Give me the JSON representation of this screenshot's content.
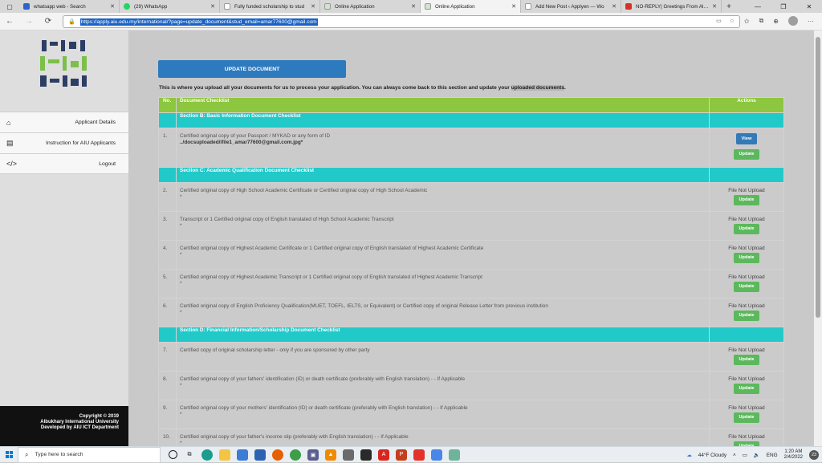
{
  "browser": {
    "tabs": [
      {
        "label": "whatsapp web - Search",
        "color": "#2a66c9"
      },
      {
        "label": "(29) WhatsApp",
        "color": "#25d366"
      },
      {
        "label": "Fully funded scholarship to stud",
        "color": "#9e9e9e"
      },
      {
        "label": "Online Application",
        "color": "#9e9e9e"
      },
      {
        "label": "Online Application",
        "color": "#9e9e9e",
        "active": true
      },
      {
        "label": "Add New Post ‹ Applyen — Wo",
        "color": "#9e9e9e"
      },
      {
        "label": "NO-REPLY| Greetings From Albu",
        "color": "#d93025"
      }
    ],
    "url": "https://apply.aiu.edu.my/international/?page=update_document&stud_email=amar77600@gmail.com"
  },
  "sidebar": {
    "items": [
      {
        "label": "Applicant Details",
        "icon": "home-icon"
      },
      {
        "label": "Instruction for AIU Applicants",
        "icon": "print-icon"
      },
      {
        "label": "Logout",
        "icon": "code-icon"
      }
    ],
    "footer": {
      "line1": "Copyright © 2019",
      "line2": "Albukhary International University",
      "line3": "Developed by AIU ICT Department"
    }
  },
  "main": {
    "update_button": "UPDATE DOCUMENT",
    "intro_text": "This is where you upload all your documents for us to process your application. You can always come back to this section and update your ",
    "intro_highlight": "uploaded documents",
    "intro_end": ".",
    "table": {
      "headers": {
        "no": "No.",
        "checklist": "Document Checklist",
        "actions": "Actions"
      },
      "section_b": "Section B: Basic Information Document Checklist",
      "section_c": "Section C: Academic Qualification Document Checklist",
      "section_d": "Section D: Financial Information/Scholarship Document Checklist",
      "rows": [
        {
          "no": "1.",
          "desc": "Certified original copy of your Passport / MYKAD or any form of ID",
          "path": "../docsuploaded/ifile1_amar77600@gmail.com.jpg",
          "star": "*"
        },
        {
          "no": "2.",
          "desc": "Certified original copy of High School Academic Certificate or Certified original copy of High School Academic",
          "star": "*",
          "status": "File Not Upload"
        },
        {
          "no": "3.",
          "desc": "Transcript or 1 Certified original copy of English translated of High School Academic Transcript",
          "star": "*",
          "status": "File Not Upload"
        },
        {
          "no": "4.",
          "desc": "Certified original copy of Highest Academic Certificate or 1 Certified original copy of English translated of Highest Academic Certificate",
          "star": "*",
          "status": "File Not Upload"
        },
        {
          "no": "5.",
          "desc": "Certified original copy of Highest Academic Transcript or 1 Certified original copy of English translated of Highest Academic Transcript",
          "star": "*",
          "status": "File Not Upload"
        },
        {
          "no": "6.",
          "desc": "Certified original copy of English Proficiency Qualification(MUET, TOEFL, IELTS, or Equivalent) or Certified copy of original Release Letter from previous institution",
          "star": "*",
          "status": "File Not Upload"
        },
        {
          "no": "7.",
          "desc": "Certified copy of original scholarship letter - only if you are sponsored by other party",
          "star": "",
          "status": "File Not Upload"
        },
        {
          "no": "8.",
          "desc": "Certified original copy of your fathers' identification (ID) or death certificate (preferably with English translation) - - If Applicable",
          "star": "*",
          "status": "File Not Upload"
        },
        {
          "no": "9.",
          "desc": "Certified original copy of your mothers' identification (ID) or death certificate (preferably with English translation) - - If Applicable",
          "star": "*",
          "status": "File Not Upload"
        },
        {
          "no": "10.",
          "desc": "Certified original copy of your father's income slip (preferably with English translation) - - If Applicable",
          "star": "*",
          "status": "File Not Upload"
        }
      ],
      "view_label": "View",
      "update_label": "Update"
    }
  },
  "taskbar": {
    "search_placeholder": "Type here to search",
    "weather": "44°F  Cloudy",
    "lang": "ENG",
    "time": "1:20 AM",
    "date": "2/4/2022",
    "notifications": "23"
  }
}
